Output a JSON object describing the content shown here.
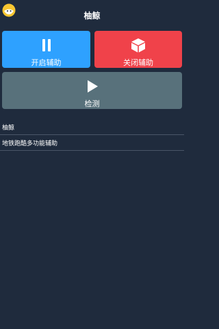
{
  "header": {
    "title": "柚鲸",
    "logo_icon": "lemon-logo-icon"
  },
  "actions": {
    "start": {
      "label": "开启辅助",
      "icon": "pause-icon",
      "color": "#2ea1ff"
    },
    "stop": {
      "label": "关闭辅助",
      "icon": "cube-icon",
      "color": "#f0424a"
    },
    "check": {
      "label": "检测",
      "icon": "play-icon",
      "color": "#58717b"
    }
  },
  "list": {
    "items": [
      {
        "label": "柚鲸"
      },
      {
        "label": "地铁跑酷多功能辅助"
      }
    ]
  },
  "colors": {
    "background": "#1f2b3d",
    "divider": "#4a5668"
  }
}
